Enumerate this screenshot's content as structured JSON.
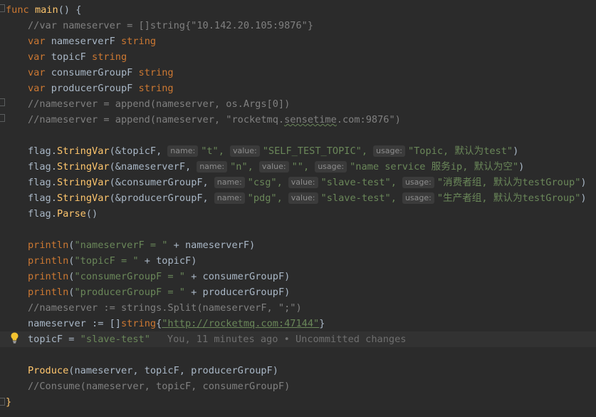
{
  "code": {
    "l1_kw": "func",
    "l1_fn": "main",
    "l1_rest": "() {",
    "l2": "//var nameserver = []string{\"10.142.20.105:9876\"}",
    "l3_kw": "var",
    "l3_name": "nameserverF",
    "l3_type": "string",
    "l4_kw": "var",
    "l4_name": "topicF",
    "l4_type": "string",
    "l5_kw": "var",
    "l5_name": "consumerGroupF",
    "l5_type": "string",
    "l6_kw": "var",
    "l6_name": "producerGroupF",
    "l6_type": "string",
    "l7": "//nameserver = append(nameserver, os.Args[0])",
    "l8_a": "//nameserver = append(nameserver, \"rocketmq.",
    "l8_b": "sensetime",
    "l8_c": ".com:9876\")",
    "flag": "flag",
    "stringvar": "StringVar",
    "parse": "Parse",
    "name_hint": "name:",
    "value_hint": "value:",
    "usage_hint": "usage:",
    "l10_ptr": "&topicF,",
    "l10_name": "\"t\",",
    "l10_value": "\"SELF_TEST_TOPIC\",",
    "l10_usage": "\"Topic, 默认为test\"",
    "l11_ptr": "&nameserverF,",
    "l11_name": "\"n\",",
    "l11_value": "\"\",",
    "l11_usage": "\"name service 服务ip, 默认为空\"",
    "l12_ptr": "&consumerGroupF,",
    "l12_name": "\"csg\",",
    "l12_value": "\"slave-test\",",
    "l12_usage": "\"消费者组, 默认为testGroup\"",
    "l13_ptr": "&producerGroupF,",
    "l13_name": "\"pdg\",",
    "l13_value": "\"slave-test\",",
    "l13_usage": "\"生产者组, 默认为testGroup\"",
    "println": "println",
    "l16_str": "\"nameserverF = \"",
    "l16_var": "nameserverF",
    "l17_str": "\"topicF = \"",
    "l17_var": "topicF",
    "l18_str": "\"consumerGroupF = \"",
    "l18_var": "consumerGroupF",
    "l19_str": "\"producerGroupF = \"",
    "l19_var": "producerGroupF",
    "l20": "//nameserver := strings.Split(nameserverF, \";\")",
    "l21_var": "nameserver",
    "l21_op": ":= []",
    "l21_type": "string",
    "l21_url": "\"http://rocketmq.com:47144\"",
    "l22_var": "topicF",
    "l22_val": "\"slave-test\"",
    "l22_blame": "You, 11 minutes ago • Uncommitted changes",
    "produce": "Produce",
    "l24_args": "(nameserver, topicF, producerGroupF)",
    "l25": "//Consume(nameserver, topicF, consumerGroupF)",
    "close": "}"
  },
  "colors": {
    "background": "#2b2b2b",
    "keyword": "#cc7832",
    "function": "#ffc66d",
    "string": "#6a8759",
    "comment": "#808080",
    "text": "#a9b7c6"
  },
  "icons": {
    "intention": "lightbulb-icon"
  }
}
